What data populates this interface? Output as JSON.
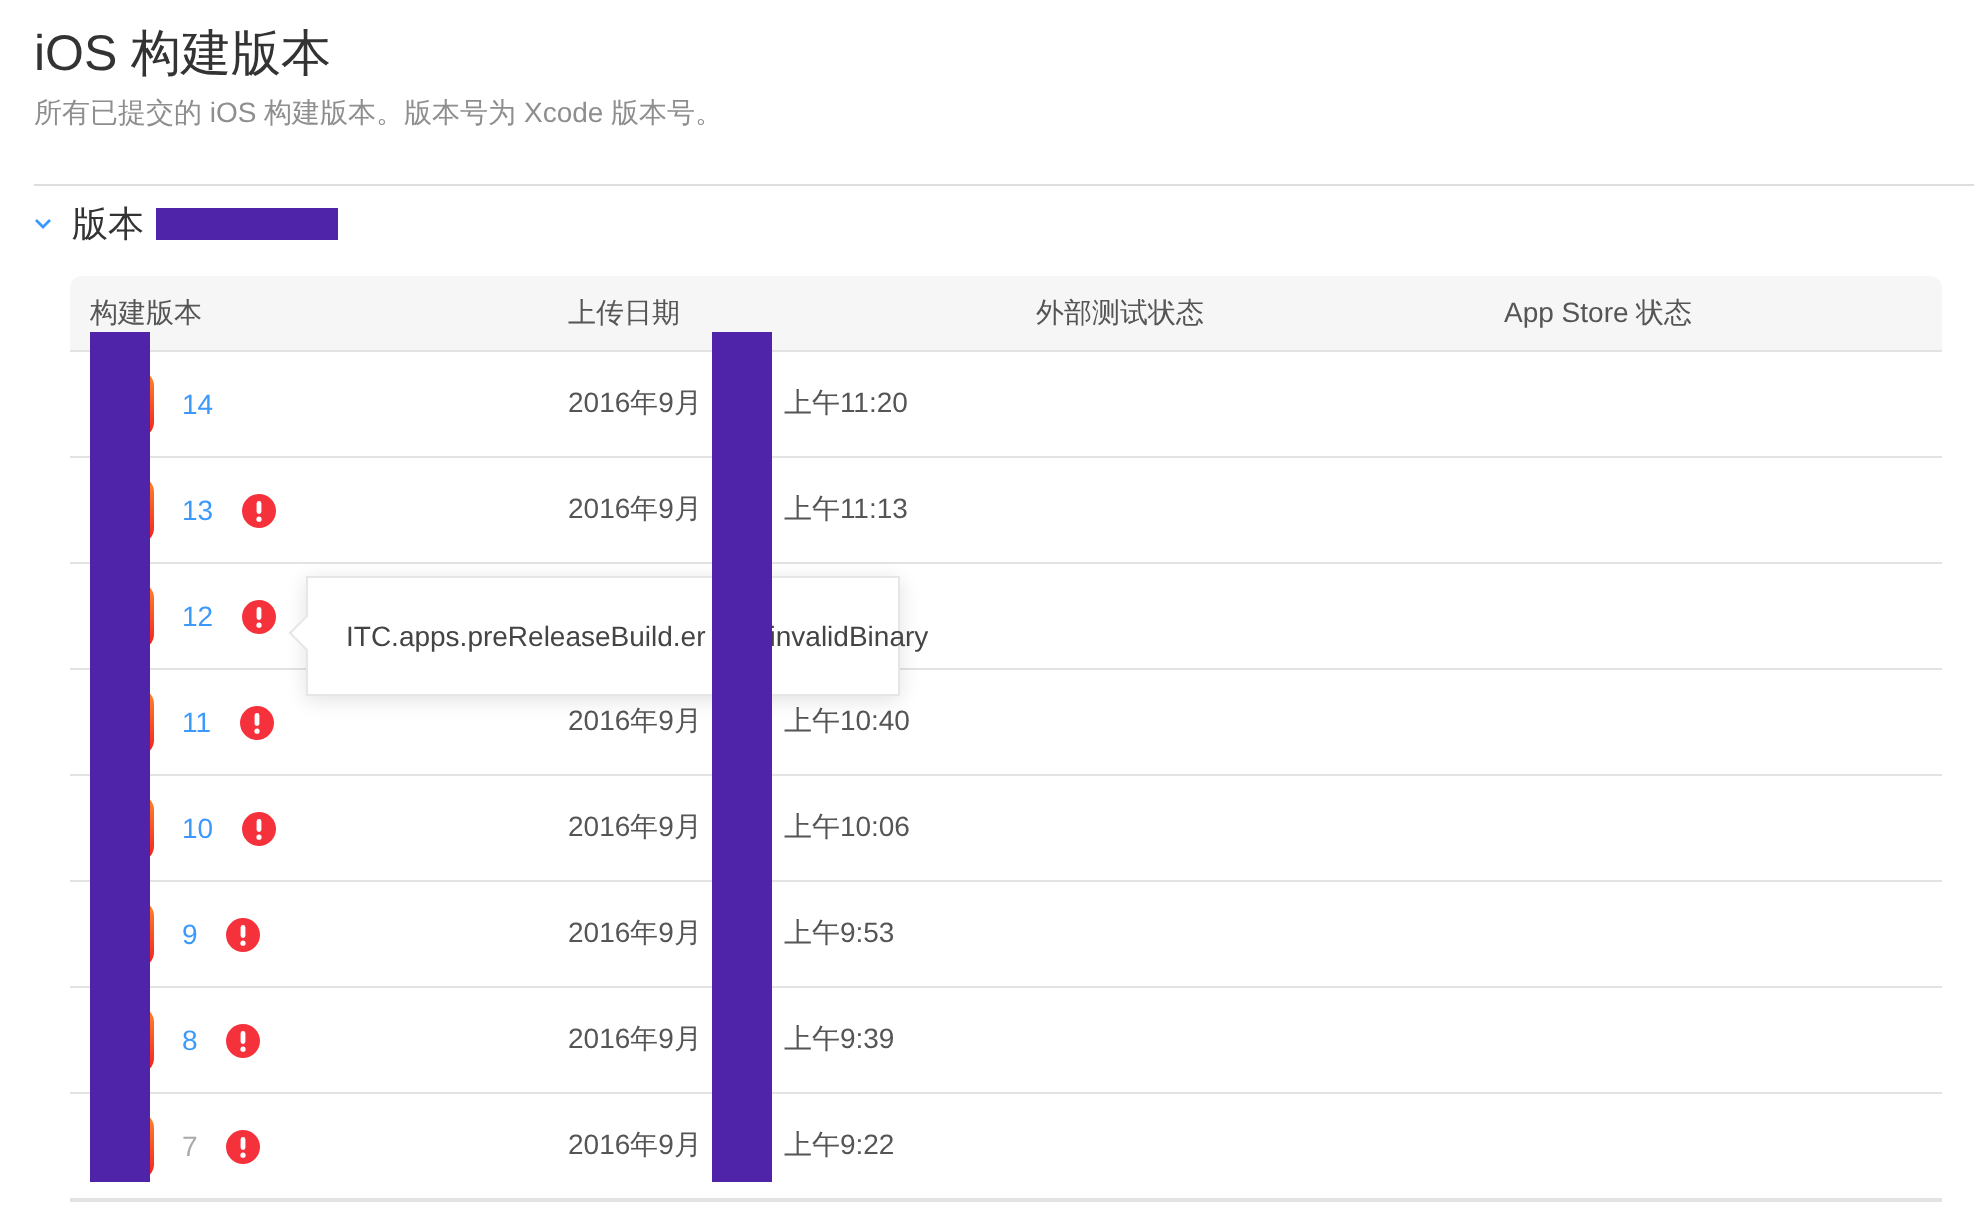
{
  "page": {
    "title": "iOS 构建版本",
    "subtitle": "所有已提交的 iOS 构建版本。版本号为 Xcode 版本号。"
  },
  "section": {
    "label": "版本",
    "expanded": true
  },
  "table": {
    "columns": [
      "构建版本",
      "上传日期",
      "外部测试状态",
      "App Store 状态"
    ],
    "rows": [
      {
        "build": "14",
        "error": false,
        "dimmed": false,
        "date": "2016年9月",
        "time": "上午11:20"
      },
      {
        "build": "13",
        "error": true,
        "dimmed": false,
        "date": "2016年9月",
        "time": "上午11:13"
      },
      {
        "build": "12",
        "error": true,
        "dimmed": false,
        "tooltip": {
          "text_parts": [
            "ITC.apps.preReleaseBuild.er",
            "invalidBinary"
          ]
        }
      },
      {
        "build": "11",
        "error": true,
        "dimmed": false,
        "date": "2016年9月",
        "time": "上午10:40"
      },
      {
        "build": "10",
        "error": true,
        "dimmed": false,
        "date": "2016年9月",
        "time": "上午10:06"
      },
      {
        "build": "9",
        "error": true,
        "dimmed": false,
        "date": "2016年9月",
        "time": "上午9:53"
      },
      {
        "build": "8",
        "error": true,
        "dimmed": false,
        "date": "2016年9月",
        "time": "上午9:39"
      },
      {
        "build": "7",
        "error": true,
        "dimmed": true,
        "date": "2016年9月",
        "time": "上午9:22"
      }
    ]
  }
}
